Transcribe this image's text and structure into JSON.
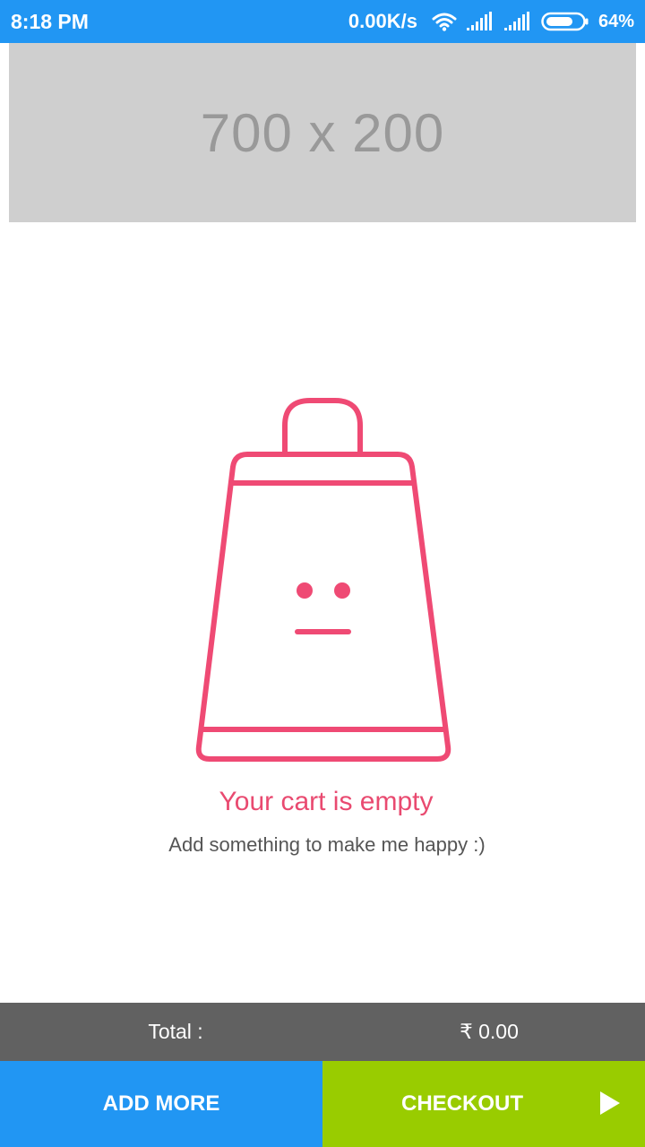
{
  "status_bar": {
    "time": "8:18 PM",
    "network_speed": "0.00K/s",
    "battery_percent": "64%",
    "icons": [
      "wifi-icon",
      "signal-icon",
      "signal-icon",
      "battery-icon"
    ],
    "background_color": "#2196f3"
  },
  "banner": {
    "placeholder_text": "700 x 200"
  },
  "empty_state": {
    "icon": "sad-shopping-bag-icon",
    "accent_color": "#e94a70",
    "title": "Your cart is empty",
    "subtitle": "Add something to make me happy :)"
  },
  "total": {
    "label": "Total :",
    "value": "₹ 0.00"
  },
  "actions": {
    "add_more_label": "ADD MORE",
    "checkout_label": "CHECKOUT",
    "checkout_icon": "play-arrow-icon",
    "add_more_color": "#2196f3",
    "checkout_color": "#99cc00"
  }
}
